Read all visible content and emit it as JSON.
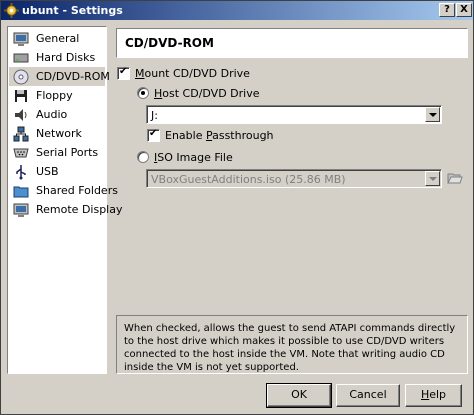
{
  "window": {
    "title": "ubunt - Settings",
    "help_label": "?",
    "close_label": "X"
  },
  "sidebar": {
    "items": [
      {
        "label": "General",
        "icon": "monitor-icon"
      },
      {
        "label": "Hard Disks",
        "icon": "hard-disk-icon"
      },
      {
        "label": "CD/DVD-ROM",
        "icon": "cd-icon"
      },
      {
        "label": "Floppy",
        "icon": "floppy-icon"
      },
      {
        "label": "Audio",
        "icon": "speaker-icon"
      },
      {
        "label": "Network",
        "icon": "network-icon"
      },
      {
        "label": "Serial Ports",
        "icon": "serial-port-icon"
      },
      {
        "label": "USB",
        "icon": "usb-icon"
      },
      {
        "label": "Shared Folders",
        "icon": "folder-icon"
      },
      {
        "label": "Remote Display",
        "icon": "remote-display-icon"
      }
    ],
    "selected_index": 2
  },
  "page": {
    "title": "CD/DVD-ROM",
    "mount_prefix": "",
    "mount_accel": "M",
    "mount_rest": "ount CD/DVD Drive",
    "mount_checked": true,
    "host_prefix": "",
    "host_accel": "H",
    "host_rest": "ost CD/DVD Drive",
    "host_selected": true,
    "host_drive_value": "J:",
    "passthrough_prefix": "Enable ",
    "passthrough_accel": "P",
    "passthrough_rest": "assthrough",
    "passthrough_checked": true,
    "iso_prefix": "",
    "iso_accel": "I",
    "iso_rest": "SO Image File",
    "iso_selected": false,
    "iso_value": "VBoxGuestAdditions.iso (25.86 MB)"
  },
  "info": {
    "text": "When checked, allows the guest to send ATAPI commands directly to the host drive which makes it possible to use CD/DVD writers connected to the host inside the VM. Note that writing audio CD inside the VM is not yet supported."
  },
  "buttons": {
    "ok": "OK",
    "cancel": "Cancel",
    "help_accel": "H",
    "help_rest": "elp"
  },
  "colors": {
    "face": "#d4d0c8",
    "title_start": "#0a246a",
    "title_end": "#a6caf0"
  }
}
